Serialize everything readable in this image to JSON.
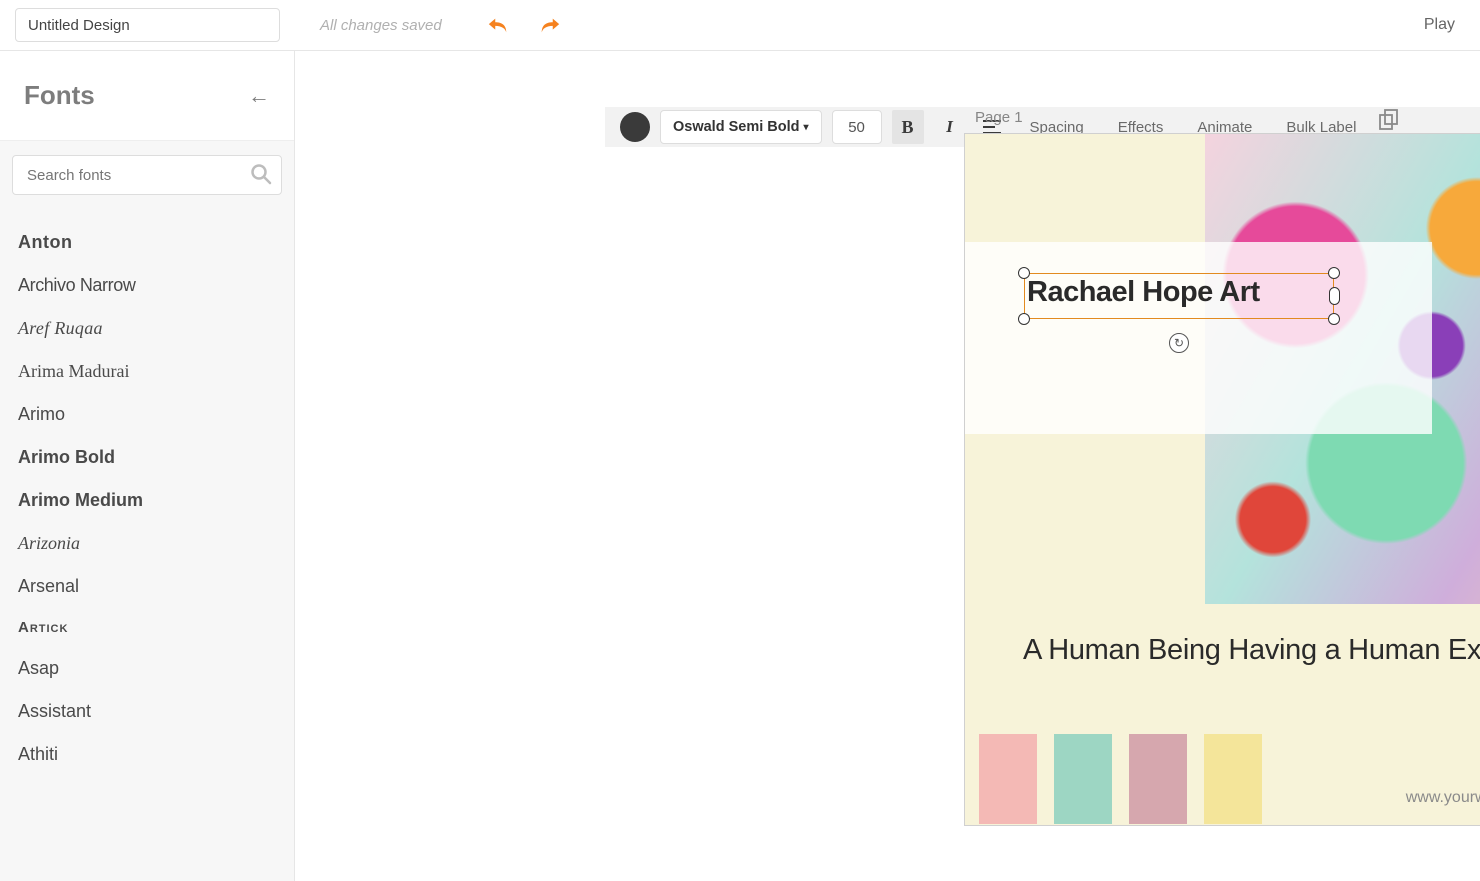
{
  "header": {
    "title_value": "Untitled Design",
    "save_status": "All changes saved",
    "play_label": "Play"
  },
  "toolbar": {
    "font_name": "Oswald Semi Bold",
    "font_size": "50",
    "bold_glyph": "B",
    "italic_glyph": "I",
    "spacing_label": "Spacing",
    "effects_label": "Effects",
    "animate_label": "Animate",
    "bulklabel_label": "Bulk Label"
  },
  "sidebar": {
    "title": "Fonts",
    "search_placeholder": "Search fonts",
    "fonts": [
      {
        "label": "Anton",
        "cls": "font-anton"
      },
      {
        "label": "Archivo Narrow",
        "cls": "font-archivo"
      },
      {
        "label": "Aref Ruqaa",
        "cls": "font-aref"
      },
      {
        "label": "Arima Madurai",
        "cls": "font-arima"
      },
      {
        "label": "Arimo",
        "cls": "font-arimo"
      },
      {
        "label": "Arimo Bold",
        "cls": "font-arimob"
      },
      {
        "label": "Arimo Medium",
        "cls": "font-arimom"
      },
      {
        "label": "Arizonia",
        "cls": "font-arizonia"
      },
      {
        "label": "Arsenal",
        "cls": "font-arsenal"
      },
      {
        "label": "Artick",
        "cls": "font-artick"
      },
      {
        "label": "Asap",
        "cls": "font-asap"
      },
      {
        "label": "Assistant",
        "cls": "font-assistant"
      },
      {
        "label": "Athiti",
        "cls": "font-athiti"
      }
    ]
  },
  "canvas": {
    "page_label": "Page 1",
    "title_text": "Rachael Hope Art",
    "subtitle_text": "A Human Being Having a Human Experience",
    "website_text": "www.yourwebsitehere.com",
    "swatches": [
      "#f4b9b5",
      "#9dd6c3",
      "#d6a7ae",
      "#f4e59a"
    ]
  }
}
